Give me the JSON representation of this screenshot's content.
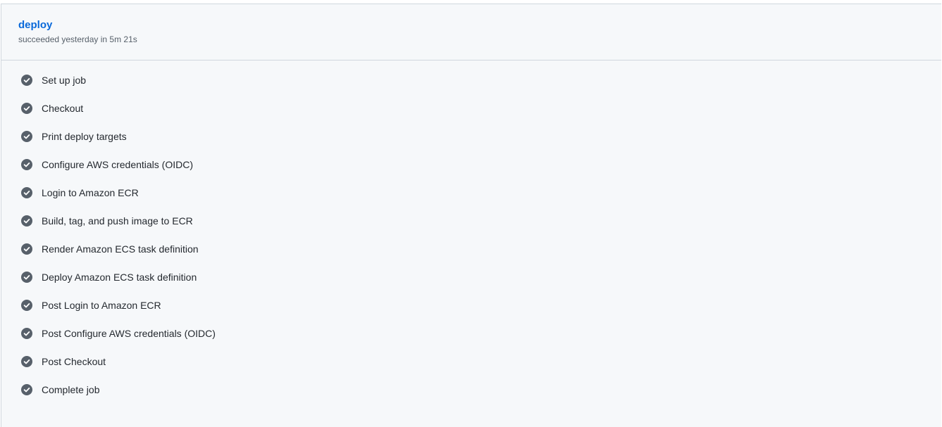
{
  "job": {
    "title": "deploy",
    "status": "succeeded yesterday in 5m 21s"
  },
  "steps": [
    {
      "label": "Set up job",
      "icon": "check-circle-icon"
    },
    {
      "label": "Checkout",
      "icon": "check-circle-icon"
    },
    {
      "label": "Print deploy targets",
      "icon": "check-circle-icon"
    },
    {
      "label": "Configure AWS credentials (OIDC)",
      "icon": "check-circle-icon"
    },
    {
      "label": "Login to Amazon ECR",
      "icon": "check-circle-icon"
    },
    {
      "label": "Build, tag, and push image to ECR",
      "icon": "check-circle-icon"
    },
    {
      "label": "Render Amazon ECS task definition",
      "icon": "check-circle-icon"
    },
    {
      "label": "Deploy Amazon ECS task definition",
      "icon": "check-circle-icon"
    },
    {
      "label": "Post Login to Amazon ECR",
      "icon": "check-circle-icon"
    },
    {
      "label": "Post Configure AWS credentials (OIDC)",
      "icon": "check-circle-icon"
    },
    {
      "label": "Post Checkout",
      "icon": "check-circle-icon"
    },
    {
      "label": "Complete job",
      "icon": "check-circle-icon"
    }
  ],
  "colors": {
    "link": "#0969da",
    "icon": "#57606a",
    "text": "#24292f",
    "panel_bg": "#f6f8fa",
    "border": "#d0d7de"
  }
}
